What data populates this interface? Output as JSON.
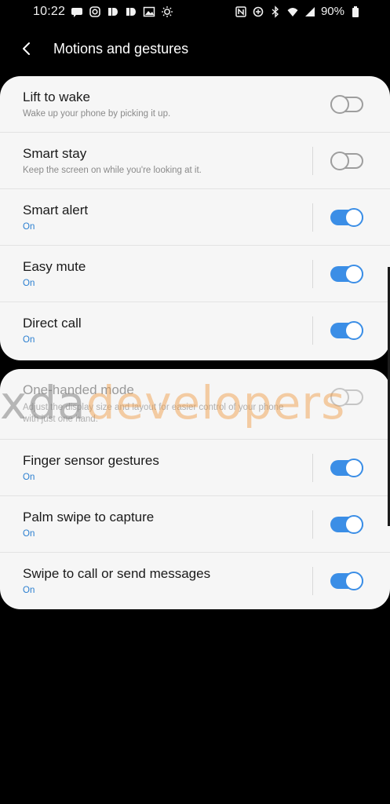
{
  "status_bar": {
    "time": "10:22",
    "battery": "90%",
    "left_icons": [
      "message-icon",
      "instagram-icon",
      "app-icon",
      "app-icon",
      "image-icon",
      "weather-icon"
    ],
    "right_icons": [
      "nfc-icon",
      "data-saver-icon",
      "bluetooth-icon",
      "wifi-icon",
      "signal-icon",
      "battery-icon"
    ]
  },
  "app_bar": {
    "title": "Motions and gestures",
    "back_icon": "back-arrow-icon"
  },
  "sections": [
    {
      "items": [
        {
          "title": "Lift to wake",
          "subtitle": "Wake up your phone by picking it up.",
          "state": "off",
          "divider": false
        },
        {
          "title": "Smart stay",
          "subtitle": "Keep the screen on while you're looking at it.",
          "state": "off",
          "divider": true
        },
        {
          "title": "Smart alert",
          "subtitle": "On",
          "state": "on",
          "divider": true
        },
        {
          "title": "Easy mute",
          "subtitle": "On",
          "state": "on",
          "divider": true
        },
        {
          "title": "Direct call",
          "subtitle": "On",
          "state": "on",
          "divider": true
        }
      ]
    },
    {
      "items": [
        {
          "title": "One-handed mode",
          "subtitle": "Adjust the display size and layout for easier control of your phone with just one hand.",
          "state": "off",
          "divider": false
        },
        {
          "title": "Finger sensor gestures",
          "subtitle": "On",
          "state": "on",
          "divider": true
        },
        {
          "title": "Palm swipe to capture",
          "subtitle": "On",
          "state": "on",
          "divider": true
        },
        {
          "title": "Swipe to call or send messages",
          "subtitle": "On",
          "state": "on",
          "divider": true
        }
      ]
    }
  ],
  "watermark": {
    "part1": "xda",
    "part2": "developers"
  },
  "colors": {
    "accent": "#3b8ee6",
    "on_text": "#2b7fd0",
    "card_bg": "#f6f6f6",
    "background": "#000000"
  }
}
